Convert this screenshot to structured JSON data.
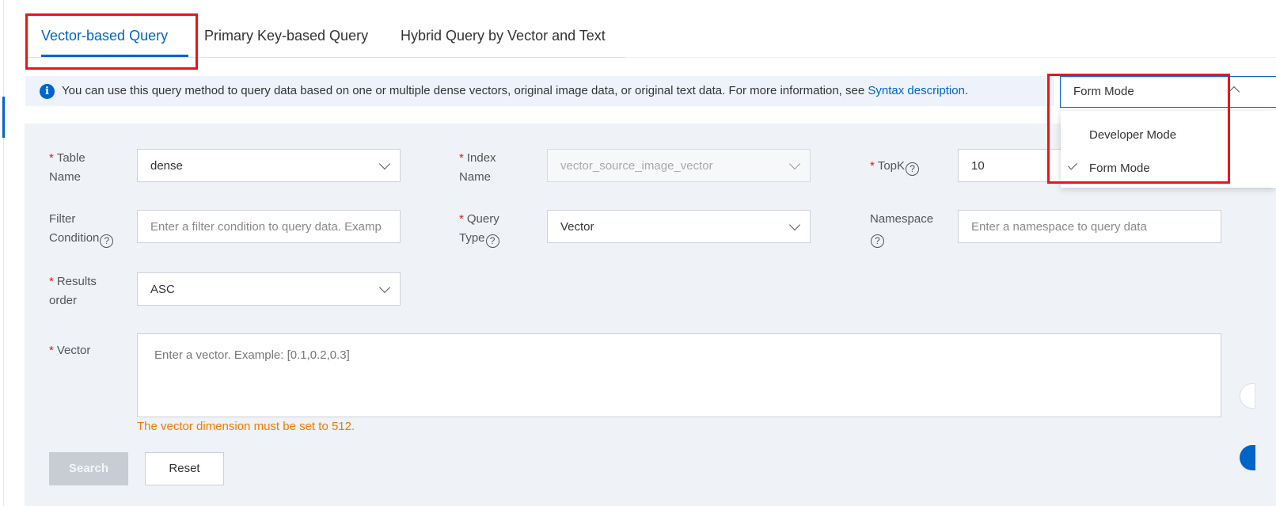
{
  "tabs": [
    {
      "label": "Vector-based Query",
      "active": true
    },
    {
      "label": "Primary Key-based Query",
      "active": false
    },
    {
      "label": "Hybrid Query by Vector and Text",
      "active": false
    }
  ],
  "info": {
    "text": "You can use this query method to query data based on one or multiple dense vectors, original image data, or original text data. For more information, see ",
    "link": "Syntax description",
    "suffix": ".",
    "icon": "info-icon"
  },
  "mode": {
    "selected": "Form Mode",
    "options": [
      {
        "label": "Developer Mode",
        "checked": false
      },
      {
        "label": "Form Mode",
        "checked": true
      }
    ]
  },
  "form": {
    "required_mark": "*",
    "table_name": {
      "label_1": "Table",
      "label_2": "Name",
      "value": "dense"
    },
    "index_name": {
      "label_1": "Index",
      "label_2": "Name",
      "value": "vector_source_image_vector"
    },
    "topk": {
      "label": "TopK",
      "value": "10"
    },
    "filter": {
      "label_1": "Filter",
      "label_2": "Condition",
      "placeholder": "Enter a filter condition to query data. Examp"
    },
    "query_type": {
      "label_1": "Query",
      "label_2": "Type",
      "value": "Vector"
    },
    "namespace": {
      "label": "Namespace",
      "placeholder": "Enter a namespace to query data"
    },
    "results_order": {
      "label_1": "Results",
      "label_2": "order",
      "value": "ASC"
    },
    "vector": {
      "label": "Vector",
      "placeholder": "Enter a vector. Example: [0.1,0.2,0.3]",
      "warning": "The vector dimension must be set to 512."
    },
    "help_glyph": "?"
  },
  "buttons": {
    "search": "Search",
    "reset": "Reset"
  },
  "colors": {
    "accent": "#0064c8",
    "highlight": "#e8151b",
    "warning": "#f07b00",
    "panel": "#eff2f7"
  }
}
